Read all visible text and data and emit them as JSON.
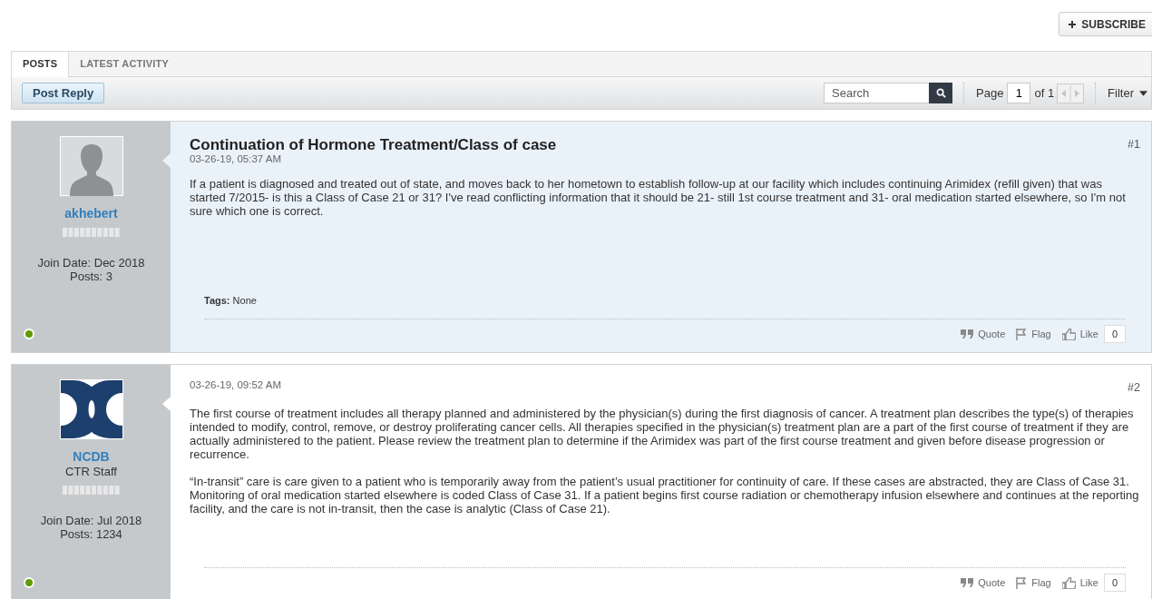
{
  "subscribe_button": {
    "label": "SUBSCRIBE"
  },
  "tabs": [
    {
      "label": "POSTS",
      "selected": true
    },
    {
      "label": "LATEST ACTIVITY",
      "selected": false
    }
  ],
  "toolbar": {
    "post_reply": "Post Reply",
    "search": {
      "placeholder": "Search"
    },
    "pagination": {
      "label": "Page",
      "value": "1",
      "total": "of 1"
    },
    "filter": "Filter"
  },
  "posts": [
    {
      "number": "#1",
      "title": "Continuation of Hormone Treatment/Class of case",
      "date": "03-26-19, 05:37 AM",
      "highlighted": true,
      "author": {
        "avatar": {
          "kind": "silhouette"
        },
        "username": "akhebert",
        "join_date": "Join Date: Dec 2018",
        "posts": "Posts: 3",
        "online": true
      },
      "paragraphs": [
        "If a patient is diagnosed and treated out of state, and moves back to her hometown to establish follow-up at our facility which includes continuing Arimidex (refill given) that was started 7/2015- is this a Class of Case 21 or 31? I've read conflicting information that it should be 21- still 1st course treatment and 31- oral medication started elsewhere, so I'm not sure which one is correct."
      ],
      "tags": {
        "label": "Tags:",
        "value": "None"
      },
      "actions": {
        "quote": "Quote",
        "flag": "Flag",
        "like": "Like",
        "like_count": "0"
      }
    },
    {
      "number": "#2",
      "date": "03-26-19, 09:52 AM",
      "highlighted": false,
      "author": {
        "avatar": {
          "kind": "logo"
        },
        "username": "NCDB",
        "user_title": "CTR Staff",
        "join_date": "Join Date: Jul 2018",
        "posts": "Posts: 1234",
        "online": true
      },
      "paragraphs": [
        "The first course of treatment includes all therapy planned and administered by the physician(s) during the first diagnosis of cancer. A treatment plan describes the type(s) of therapies intended to modify, control, remove, or destroy proliferating cancer cells. All therapies specified in the physician(s) treatment plan are a part of the first course of treatment if they are actually administered to the patient. Please review the treatment plan to determine if the Arimidex was part of the first course treatment and given before disease progression or recurrence.",
        "“In-transit” care is care given to a patient who is temporarily away from the patient’s usual practitioner for continuity of care. If these cases are abstracted, they are Class of Case 31. Monitoring of oral medication started elsewhere is coded Class of Case 31. If a patient begins first course radiation or chemotherapy infusion elsewhere and continues at the reporting facility, and the care is not in-transit, then the case is analytic (Class of Case 21)."
      ],
      "actions": {
        "quote": "Quote",
        "flag": "Flag",
        "like": "Like",
        "like_count": "0"
      }
    }
  ]
}
